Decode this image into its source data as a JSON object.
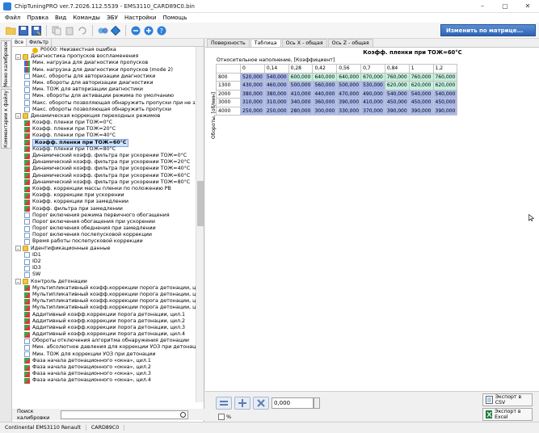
{
  "window": {
    "title": "ChipTuningPRO ver.7.2026.112.5539 - EMS3110_CARD89C0.bin",
    "controls": [
      "–",
      "▢",
      "✕"
    ]
  },
  "menu": [
    "Файл",
    "Правка",
    "Вид",
    "Команды",
    "ЭБУ",
    "Настройки",
    "Помощь"
  ],
  "toolbar": {
    "icons": [
      "open-folder-icon",
      "save-icon",
      "save-as-icon",
      "copy-icon",
      "paste-icon",
      "undo-icon",
      "compare-icon",
      "checksum-icon",
      "read-ecu-icon",
      "write-ecu-icon",
      "help-icon"
    ],
    "matrix_button": "Изменить по матрице..."
  },
  "side_tabs": [
    "Меню калибровок",
    "Комментарии к файлу"
  ],
  "filter_tabs": [
    "Все",
    "Фильтр"
  ],
  "tree": [
    {
      "level": 2,
      "icon": "warn",
      "text": "P0000: Неизвестная ошибка"
    },
    {
      "level": 0,
      "icon": "folder",
      "exp": "–",
      "text": "Диагностика пропусков воспламенения"
    },
    {
      "level": 1,
      "icon": "bar",
      "text": "Мин. нагрузка для диагностики пропусков"
    },
    {
      "level": 1,
      "icon": "bar",
      "text": "Мин. нагрузка для диагностики пропусков (mode 2)"
    },
    {
      "level": 1,
      "icon": "doc",
      "text": "Макс. обороты для авторизации диагностики"
    },
    {
      "level": 1,
      "icon": "doc",
      "text": "Мин. обороты для авторизации диагностики"
    },
    {
      "level": 1,
      "icon": "doc",
      "text": "Мин. ТОЖ для авторизации диагностики"
    },
    {
      "level": 1,
      "icon": "doc",
      "text": "Мин. обороты для активации режима по умолчанию"
    },
    {
      "level": 1,
      "icon": "doc",
      "text": "Макс. обороты  позволяющая обнаружить пропуски при не зак"
    },
    {
      "level": 1,
      "icon": "doc",
      "text": "Макс. обороты позволяющая обнаружить пропуски"
    },
    {
      "level": 0,
      "icon": "folder",
      "exp": "–",
      "text": "Динамическая коррекция переходных режимов"
    },
    {
      "level": 1,
      "icon": "chart",
      "text": "Коэфф. пленки при ТОЖ=0°C"
    },
    {
      "level": 1,
      "icon": "chart",
      "text": "Коэфф. пленки при ТОЖ=20°C"
    },
    {
      "level": 1,
      "icon": "chart",
      "text": "Коэфф. пленки при ТОЖ=40°C"
    },
    {
      "level": 1,
      "icon": "chart",
      "text": "Коэфф. пленки при ТОЖ=60°C",
      "selected": true
    },
    {
      "level": 1,
      "icon": "chart",
      "text": "Коэфф. пленки при ТОЖ=80°C"
    },
    {
      "level": 1,
      "icon": "chart",
      "text": "Динамический коэфф. фильтра при ускорении ТОЖ=0°C"
    },
    {
      "level": 1,
      "icon": "chart",
      "text": "Динамический коэфф. фильтра при ускорении ТОЖ=20°C"
    },
    {
      "level": 1,
      "icon": "chart",
      "text": "Динамический коэфф. фильтра при ускорении ТОЖ=40°C"
    },
    {
      "level": 1,
      "icon": "chart",
      "text": "Динамический коэфф. фильтра при ускорении ТОЖ=60°C"
    },
    {
      "level": 1,
      "icon": "chart",
      "text": "Динамический коэфф. фильтра при ускорении ТОЖ=80°C"
    },
    {
      "level": 1,
      "icon": "chart",
      "text": "Коэфф. коррекции массы пленки по положению РВ"
    },
    {
      "level": 1,
      "icon": "chart",
      "text": "Коэфф. коррекции при ускорении"
    },
    {
      "level": 1,
      "icon": "chart",
      "text": "Коэфф. коррекции при замедлении"
    },
    {
      "level": 1,
      "icon": "chart",
      "text": "Коэфф. фильтра при замедлении"
    },
    {
      "level": 1,
      "icon": "doc",
      "text": "Порог включения режима первичного обогащения"
    },
    {
      "level": 1,
      "icon": "doc",
      "text": "Порог включения обогащения при ускорении"
    },
    {
      "level": 1,
      "icon": "doc",
      "text": "Порог включения обеднения при замедлении"
    },
    {
      "level": 1,
      "icon": "doc",
      "text": "Порог включения послепусковой коррекции"
    },
    {
      "level": 1,
      "icon": "doc",
      "text": "Время работы послепусковой коррекции"
    },
    {
      "level": 0,
      "icon": "folder",
      "exp": "–",
      "text": "Идентификационные данные"
    },
    {
      "level": 1,
      "icon": "doc",
      "text": "ID1"
    },
    {
      "level": 1,
      "icon": "doc",
      "text": "ID2"
    },
    {
      "level": 1,
      "icon": "doc",
      "text": "ID3"
    },
    {
      "level": 1,
      "icon": "doc",
      "text": "SW"
    },
    {
      "level": 0,
      "icon": "folder",
      "exp": "–",
      "text": "Контроль детонации"
    },
    {
      "level": 1,
      "icon": "chart",
      "text": "Мультипликативный коэфф.коррекции порога детонации, цил."
    },
    {
      "level": 1,
      "icon": "chart",
      "text": "Мультипликативный коэфф.коррекции порога детонации, цил."
    },
    {
      "level": 1,
      "icon": "chart",
      "text": "Мультипликативный коэфф.коррекции порога детонации, цил."
    },
    {
      "level": 1,
      "icon": "chart",
      "text": "Мультипликативный коэфф.коррекции порога детонации, цил."
    },
    {
      "level": 1,
      "icon": "chart",
      "text": "Аддитивный коэфф.коррекции порога детонации, цил.1"
    },
    {
      "level": 1,
      "icon": "chart",
      "text": "Аддитивный коэфф.коррекции порога детонации, цил.2"
    },
    {
      "level": 1,
      "icon": "chart",
      "text": "Аддитивный коэфф.коррекции порога детонации, цил.3"
    },
    {
      "level": 1,
      "icon": "chart",
      "text": "Аддитивный коэфф.коррекции порога детонации, цил.4"
    },
    {
      "level": 1,
      "icon": "doc",
      "text": "Обороты отключения алгоритма обнаружения детонации"
    },
    {
      "level": 1,
      "icon": "doc",
      "text": "Мин. абсолютное давления для коррекции УОЗ при детонации"
    },
    {
      "level": 1,
      "icon": "doc",
      "text": "Мин. ТОЖ для коррекции УОЗ при детонации"
    },
    {
      "level": 1,
      "icon": "chart",
      "text": "Фаза начала детонационного «окна», цил.1"
    },
    {
      "level": 1,
      "icon": "chart",
      "text": "Фаза начала детонационного «окна», цил.2"
    },
    {
      "level": 1,
      "icon": "chart",
      "text": "Фаза начала детонационного «окна», цил.3"
    },
    {
      "level": 1,
      "icon": "chart",
      "text": "Фаза начала детонационного «окна», цил.4"
    }
  ],
  "search": {
    "label": "Поиск калибровки",
    "value": ""
  },
  "right_tabs": [
    "Поверхность",
    "Таблица",
    "Ось X - общая",
    "Ось Z - общая"
  ],
  "map": {
    "title": "Коэфф. пленки при ТОЖ=60°C",
    "x_axis_label": "Относительное наполнение, [Коэффициент]",
    "y_axis_label": "Обороты, [об/мин]",
    "x_headers": [
      "0",
      "0,14",
      "0,28",
      "0,42",
      "0,56",
      "0,7",
      "0,84",
      "1",
      "1,2"
    ],
    "rows": [
      {
        "rpm": "800",
        "values": [
          "520,000",
          "540,000",
          "600,000",
          "640,000",
          "640,000",
          "670,000",
          "760,000",
          "760,000",
          "760,000"
        ]
      },
      {
        "rpm": "1300",
        "values": [
          "430,000",
          "460,000",
          "500,000",
          "560,000",
          "500,000",
          "530,000",
          "620,000",
          "620,000",
          "620,000"
        ]
      },
      {
        "rpm": "2000",
        "values": [
          "380,000",
          "380,000",
          "410,000",
          "440,000",
          "470,000",
          "490,000",
          "540,000",
          "540,000",
          "540,000"
        ]
      },
      {
        "rpm": "3000",
        "values": [
          "310,000",
          "310,000",
          "340,000",
          "360,000",
          "390,000",
          "410,000",
          "450,000",
          "450,000",
          "450,000"
        ]
      },
      {
        "rpm": "4000",
        "values": [
          "250,000",
          "250,000",
          "280,000",
          "300,000",
          "330,000",
          "370,000",
          "390,000",
          "390,000",
          "390,000"
        ]
      }
    ]
  },
  "bottom": {
    "value": "0,000",
    "percent_label": "%",
    "export_csv": "Экспорт в CSV",
    "export_excel": "Экспорт в Excel"
  },
  "status": [
    "Continental EMS3110 Renault",
    "CARD89C0"
  ],
  "colors": {
    "cell_blue": "#aab8ec",
    "cell_green": "#c4f0dd",
    "matrix_button": "#3b73c6"
  }
}
